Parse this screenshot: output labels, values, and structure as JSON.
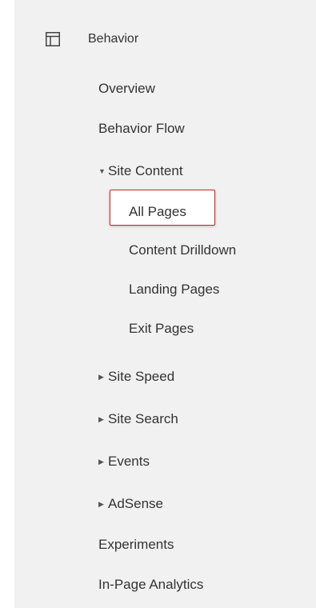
{
  "section": {
    "title": "Behavior",
    "icon": "layout-icon"
  },
  "menu": {
    "overview": "Overview",
    "behavior_flow": "Behavior Flow",
    "site_content": {
      "label": "Site Content",
      "expanded": true,
      "children": [
        "All Pages",
        "Content Drilldown",
        "Landing Pages",
        "Exit Pages"
      ],
      "selected": "All Pages"
    },
    "site_speed": "Site Speed",
    "site_search": "Site Search",
    "events": "Events",
    "adsense": "AdSense",
    "experiments": "Experiments",
    "in_page_analytics": "In-Page Analytics"
  },
  "colors": {
    "highlight_border": "#d0262a",
    "panel_bg": "#f1f1f1",
    "text": "#333333"
  }
}
